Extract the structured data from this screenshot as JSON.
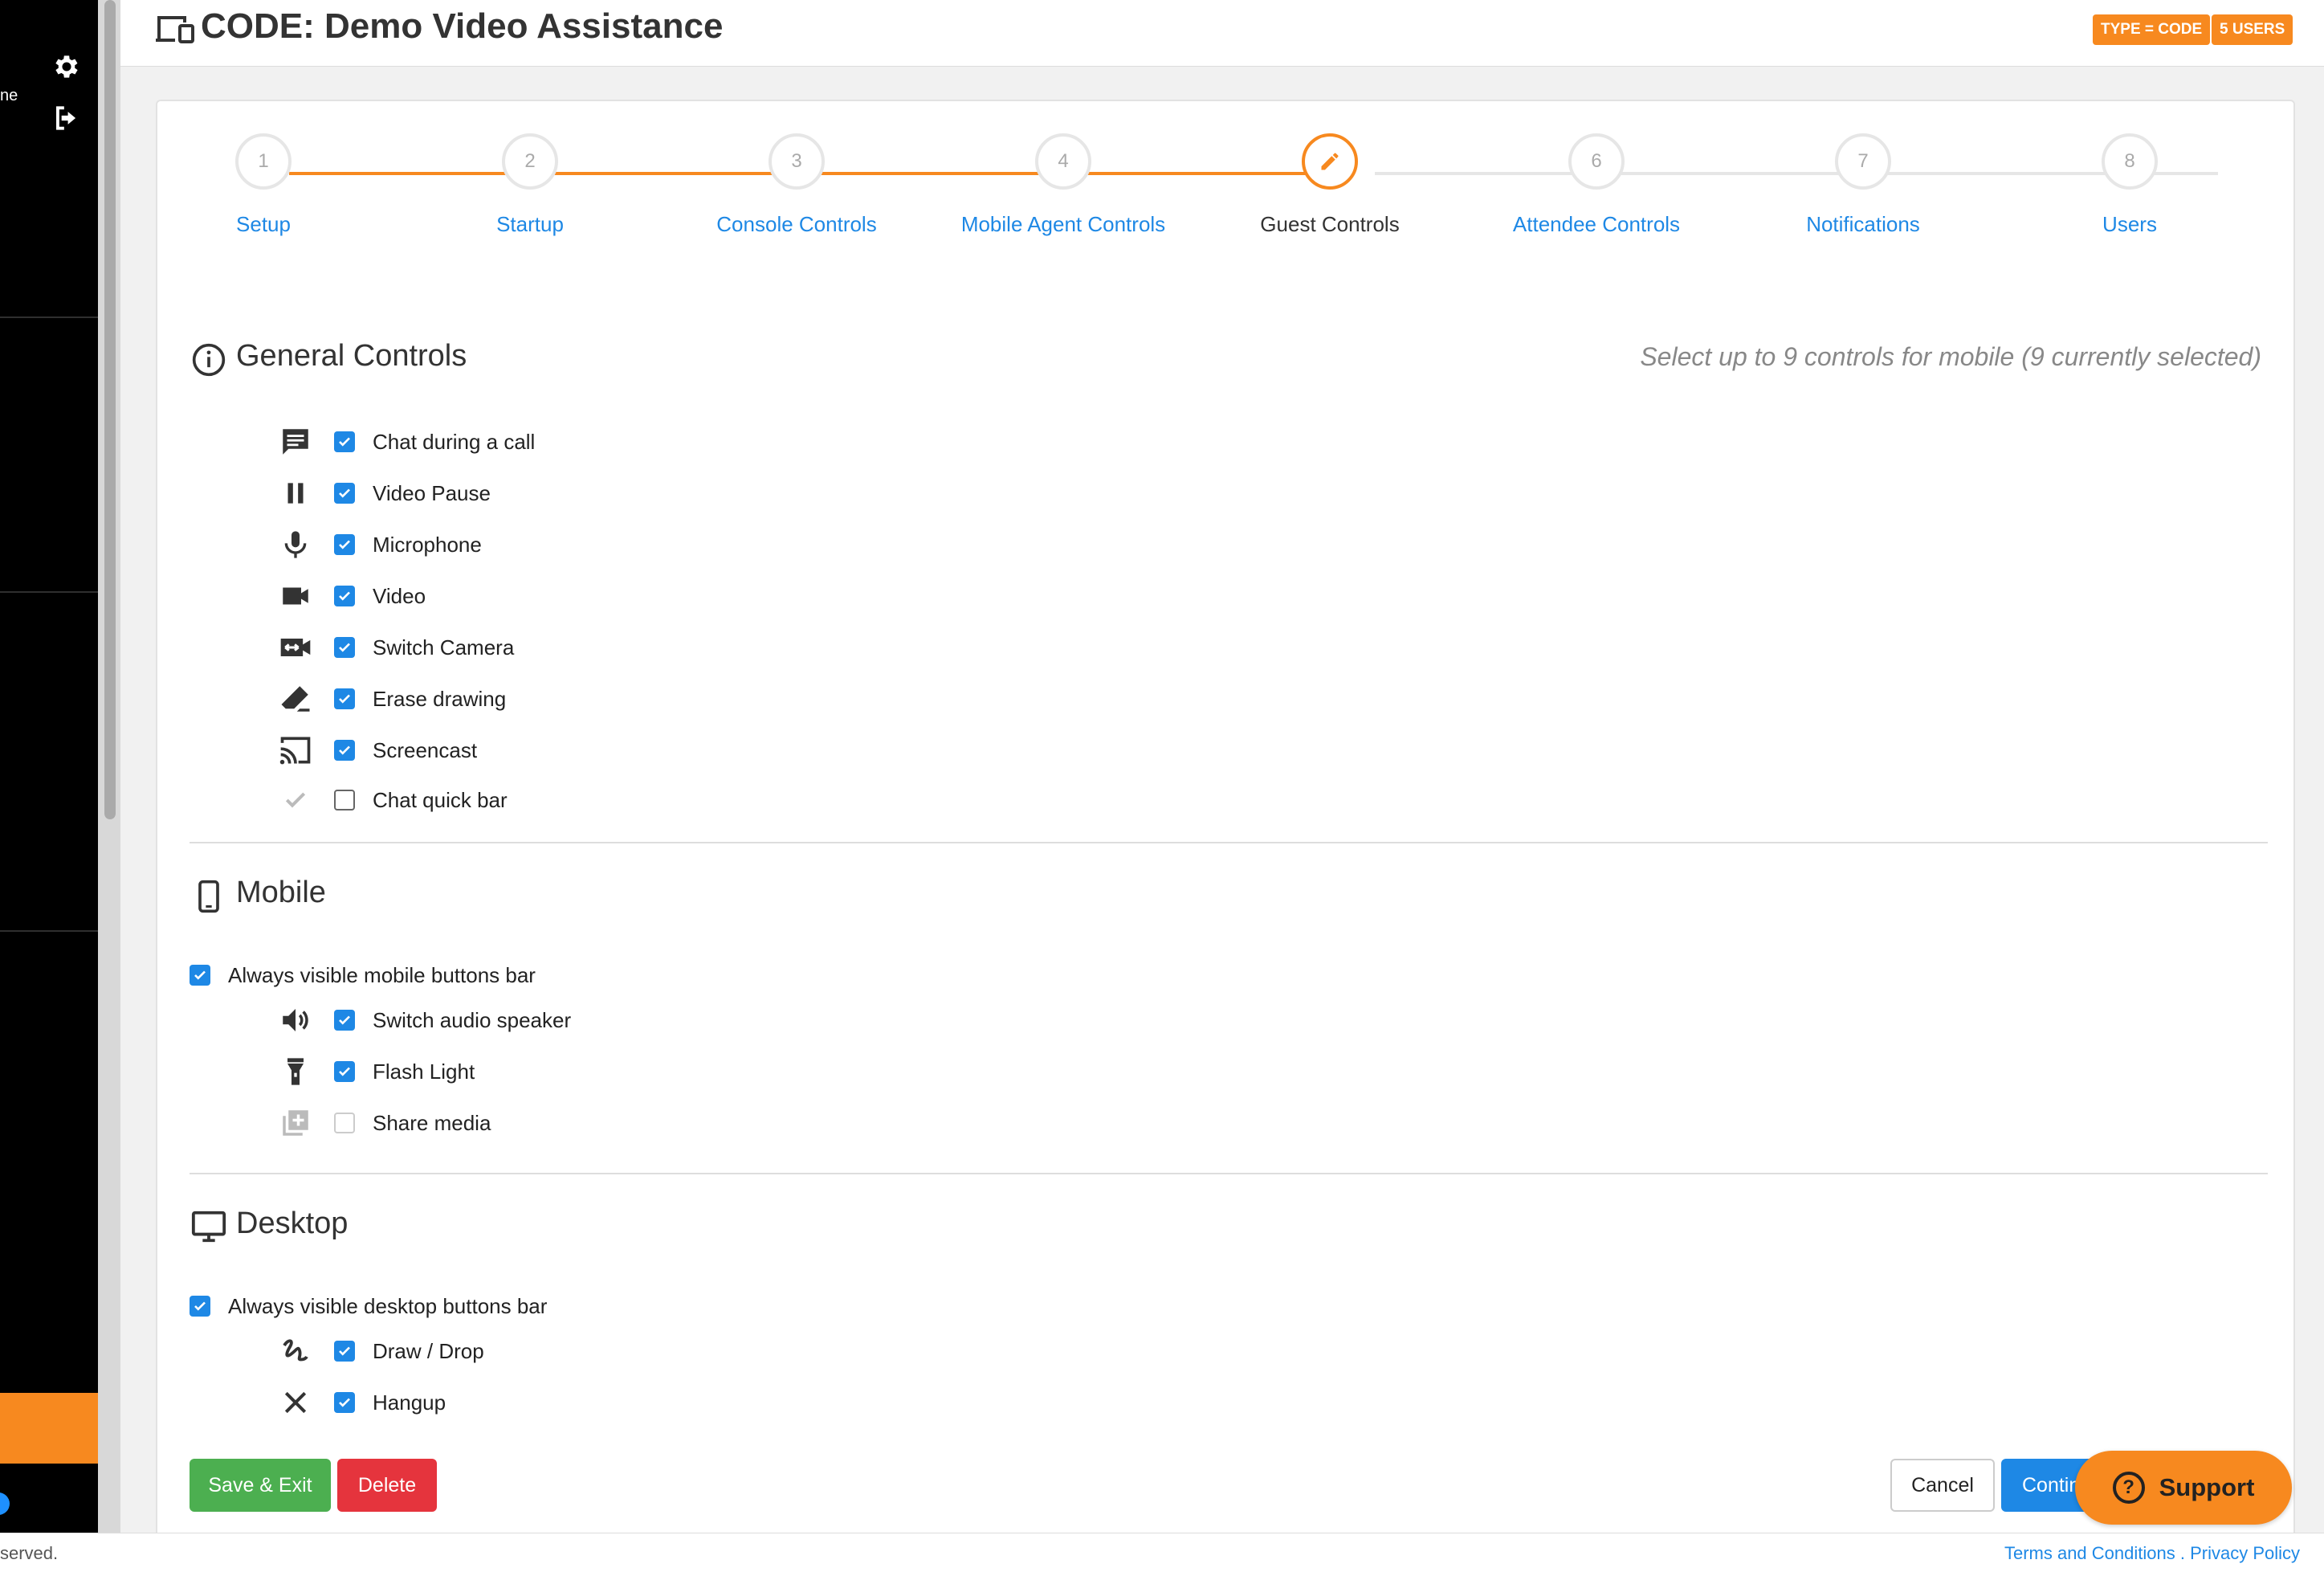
{
  "sidebar": {
    "cut_text": "ne",
    "icons": [
      "gear-icon",
      "logout-icon"
    ]
  },
  "header": {
    "title": "CODE: Demo Video Assistance",
    "badges": [
      "TYPE = CODE",
      "5 USERS"
    ],
    "accent": "#f7891f"
  },
  "stepper": {
    "steps": [
      {
        "number": "1",
        "label": "Setup"
      },
      {
        "number": "2",
        "label": "Startup"
      },
      {
        "number": "3",
        "label": "Console Controls"
      },
      {
        "number": "4",
        "label": "Mobile Agent Controls"
      },
      {
        "number": "",
        "label": "Guest Controls",
        "icon": "pencil-icon"
      },
      {
        "number": "6",
        "label": "Attendee Controls"
      },
      {
        "number": "7",
        "label": "Notifications"
      },
      {
        "number": "8",
        "label": "Users"
      }
    ],
    "current_step": 5
  },
  "general": {
    "title": "General Controls",
    "hint": "Select up to 9 controls for mobile (9 currently selected)",
    "items": [
      {
        "label": "Chat during a call",
        "icon": "chat-icon",
        "checked": true
      },
      {
        "label": "Video Pause",
        "icon": "pause-icon",
        "checked": true
      },
      {
        "label": "Microphone",
        "icon": "microphone-icon",
        "checked": true
      },
      {
        "label": "Video",
        "icon": "video-camera-icon",
        "checked": true
      },
      {
        "label": "Switch Camera",
        "icon": "switch-camera-icon",
        "checked": true
      },
      {
        "label": "Erase drawing",
        "icon": "eraser-icon",
        "checked": true
      },
      {
        "label": "Screencast",
        "icon": "screencast-icon",
        "checked": true
      },
      {
        "label": "Chat quick bar",
        "icon": "check-icon",
        "checked": false
      }
    ]
  },
  "mobile": {
    "title": "Mobile",
    "always_visible": "Always visible mobile buttons bar",
    "items": [
      {
        "label": "Switch audio speaker",
        "icon": "speaker-icon",
        "checked": true
      },
      {
        "label": "Flash Light",
        "icon": "flashlight-icon",
        "checked": true
      },
      {
        "label": "Share media",
        "icon": "add-media-icon",
        "checked": false,
        "disabled": true
      }
    ]
  },
  "desktop": {
    "title": "Desktop",
    "always_visible": "Always visible desktop buttons bar",
    "items": [
      {
        "label": "Draw / Drop",
        "icon": "draw-icon",
        "checked": true
      },
      {
        "label": "Hangup",
        "icon": "close-icon",
        "checked": true
      }
    ]
  },
  "buttons": {
    "save": "Save & Exit",
    "delete": "Delete",
    "cancel": "Cancel",
    "continue": "Continue"
  },
  "support": {
    "label": "Support",
    "glyph": "?"
  },
  "footer": {
    "left": "served.",
    "terms": "Terms and Conditions",
    "separator": " . ",
    "privacy": "Privacy Policy"
  }
}
